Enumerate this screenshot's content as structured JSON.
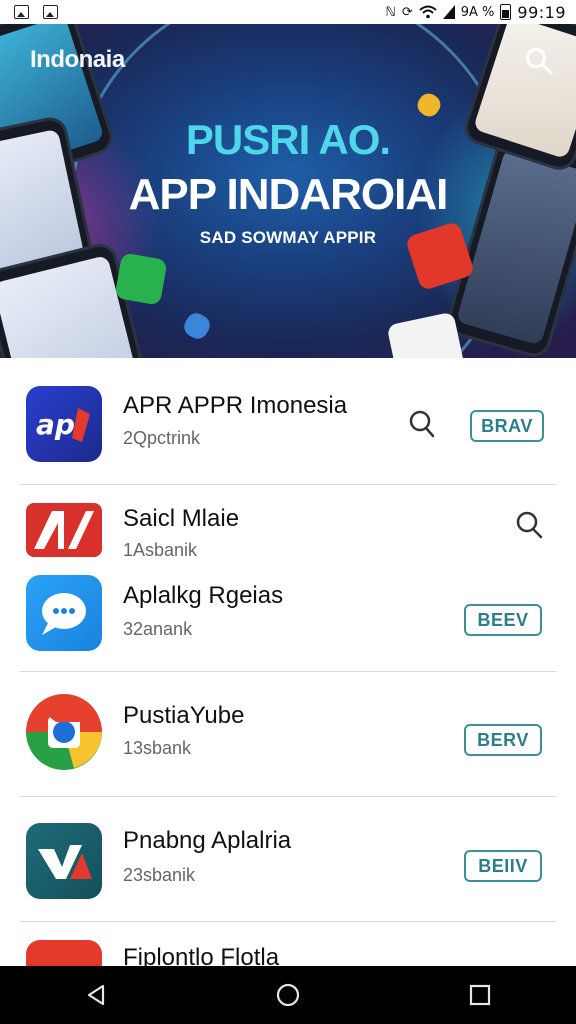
{
  "status_bar": {
    "signal_text": "9A %",
    "time": "99:19",
    "icons": [
      "image-icon",
      "gallery-icon",
      "nfc-icon",
      "sync-icon",
      "wifi-icon",
      "signal-icon",
      "battery-icon"
    ]
  },
  "banner": {
    "brand": "Indonaia",
    "headline_line1": "PUSRI AO.",
    "headline_line2": "APP INDAROIAI",
    "subtitle": "SAD SOWMAY APPIR",
    "search_icon": "search-icon"
  },
  "apps": [
    {
      "name": "APR APPR Imonesia",
      "sub": "2Qpctrink",
      "icon": "app-logo-apr-icon",
      "action": "search-icon",
      "button": "BRAV"
    },
    {
      "name": "Saicl Mlaie",
      "sub": "1Asbanik",
      "icon": "app-logo-red-n-icon",
      "action": "search-icon",
      "button": ""
    },
    {
      "name": "Aplalkg Rgeias",
      "sub": "32anank",
      "icon": "app-logo-chat-bubble-icon",
      "action": "",
      "button": "BEEV"
    },
    {
      "name": "PustiaYube",
      "sub": "13sbank",
      "icon": "app-logo-chrome-icon",
      "action": "",
      "button": "BERV"
    },
    {
      "name": "Pnabng Aplalria",
      "sub": "23sbanik",
      "icon": "app-logo-va-icon",
      "action": "",
      "button": "BEIIV"
    },
    {
      "name": "Fiplontlo Flotla",
      "sub": "",
      "icon": "app-logo-red-icon",
      "action": "",
      "button": ""
    }
  ],
  "colors": {
    "accent": "#2d7e8a",
    "banner_bg": "#1a3f7e",
    "headline_cyan": "#4fd6e8"
  },
  "nav": {
    "back": "back-icon",
    "home": "home-icon",
    "recents": "recents-icon"
  }
}
